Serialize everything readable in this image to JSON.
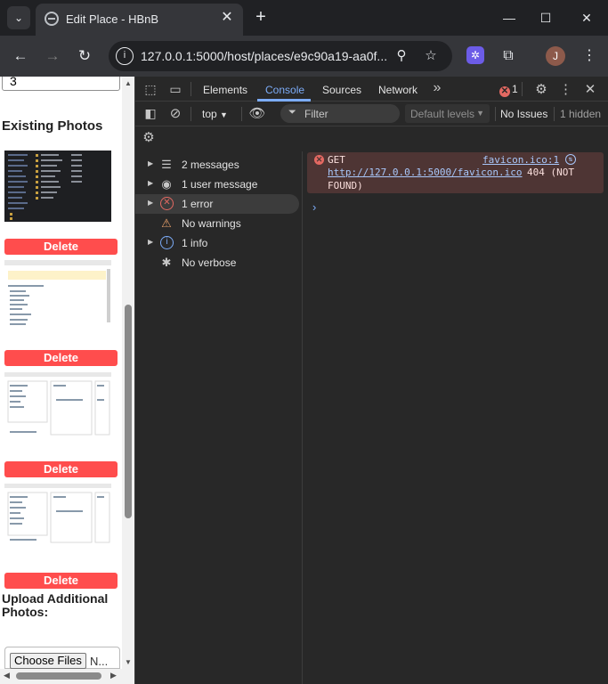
{
  "browser": {
    "tab_title": "Edit Place - HBnB",
    "tab_close": "✕",
    "new_tab": "+",
    "url": "127.0.0.1:5000/host/places/e9c90a19-aa0f...",
    "avatar_initial": "J",
    "window_controls": {
      "minimize": "—",
      "maximize": "☐",
      "close": "✕"
    },
    "icons": [
      "back-icon",
      "forward-icon",
      "reload-icon",
      "site-info-icon",
      "zoom-icon",
      "bookmark-star-icon",
      "extension-icon",
      "extensions-puzzle-icon",
      "menu-kebab-icon"
    ]
  },
  "page": {
    "number_value": "3",
    "existing_photos_heading": "Existing Photos",
    "delete_label": "Delete",
    "photos": [
      {
        "theme": "dark"
      },
      {
        "theme": "light"
      },
      {
        "theme": "light"
      },
      {
        "theme": "light"
      }
    ],
    "upload_heading": "Upload Additional Photos:",
    "choose_files_label": "Choose Files",
    "no_file_text": "N..."
  },
  "devtools": {
    "tabs": [
      "Elements",
      "Console",
      "Sources",
      "Network"
    ],
    "active_tab": "Console",
    "more_tabs": "»",
    "error_badge_count": "1",
    "context": "top",
    "filter_placeholder": "Filter",
    "levels_label": "Default levels",
    "issues_label": "No Issues",
    "hidden_label": "1 hidden",
    "accent_color": "#7cacf8",
    "error_color": "#e46962",
    "sidebar": [
      {
        "label": "2 messages",
        "icon": "list-icon",
        "expandable": true
      },
      {
        "label": "1 user message",
        "icon": "user-circle-icon",
        "expandable": true
      },
      {
        "label": "1 error",
        "icon": "error-circle-icon",
        "expandable": true,
        "selected": true
      },
      {
        "label": "No warnings",
        "icon": "warning-triangle-icon",
        "expandable": false
      },
      {
        "label": "1 info",
        "icon": "info-circle-icon",
        "expandable": true
      },
      {
        "label": "No verbose",
        "icon": "bug-icon",
        "expandable": false
      }
    ],
    "console_message": {
      "method": "GET",
      "source": "favicon.ico:1",
      "link": "http://127.0.0.1:5000/favicon.ico",
      "status": "404 (NOT",
      "status_cont": "FOUND)"
    },
    "prompt": "›"
  }
}
